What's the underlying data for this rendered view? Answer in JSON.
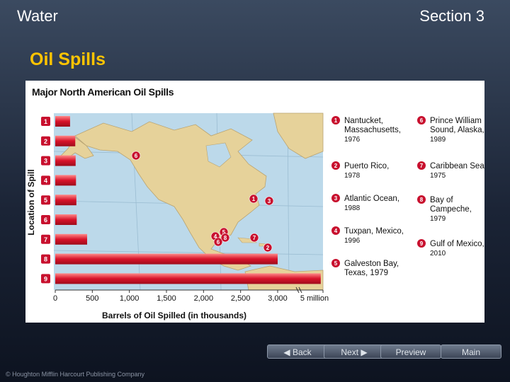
{
  "header": {
    "left": "Water",
    "right": "Section 3"
  },
  "slide_title": "Oil Spills",
  "figure_title": "Major North American Oil Spills",
  "nav": {
    "back": "Back",
    "next": "Next",
    "preview": "Preview",
    "main": "Main"
  },
  "copyright": "© Houghton Mifflin Harcourt Publishing Company",
  "chart_data": {
    "type": "bar",
    "orientation": "horizontal",
    "title": "Major North American Oil Spills",
    "xlabel": "Barrels of Oil Spilled (in thousands)",
    "ylabel": "Location of Spill",
    "categories": [
      "1",
      "2",
      "3",
      "4",
      "5",
      "6",
      "7",
      "8",
      "9"
    ],
    "values": [
      200,
      270,
      275,
      280,
      285,
      290,
      430,
      3000,
      4900
    ],
    "xticks": [
      "0",
      "500",
      "1,000",
      "1,500",
      "2,000",
      "2,500",
      "3,000",
      "5 million"
    ],
    "legend": [
      {
        "num": "1",
        "lines": [
          "Nantucket,",
          "Massachusetts,",
          "1976"
        ]
      },
      {
        "num": "2",
        "lines": [
          "Puerto Rico,",
          "1978"
        ]
      },
      {
        "num": "3",
        "lines": [
          "Atlantic Ocean,",
          "1988"
        ]
      },
      {
        "num": "4",
        "lines": [
          "Tuxpan, Mexico,",
          "1996"
        ]
      },
      {
        "num": "5",
        "lines": [
          "Galveston Bay,",
          "Texas, 1979"
        ]
      },
      {
        "num": "6",
        "lines": [
          "Prince William",
          "Sound, Alaska,",
          "1989"
        ]
      },
      {
        "num": "7",
        "lines": [
          "Caribbean Sea,",
          "1975"
        ]
      },
      {
        "num": "8",
        "lines": [
          "Bay of",
          "Campeche,",
          "1979"
        ]
      },
      {
        "num": "9",
        "lines": [
          "Gulf of Mexico,",
          "2010"
        ]
      }
    ],
    "colors": {
      "bar": "#d8132a",
      "marker": "#c8102e",
      "land": "#e6d29a",
      "water": "#bcd9ea"
    }
  }
}
